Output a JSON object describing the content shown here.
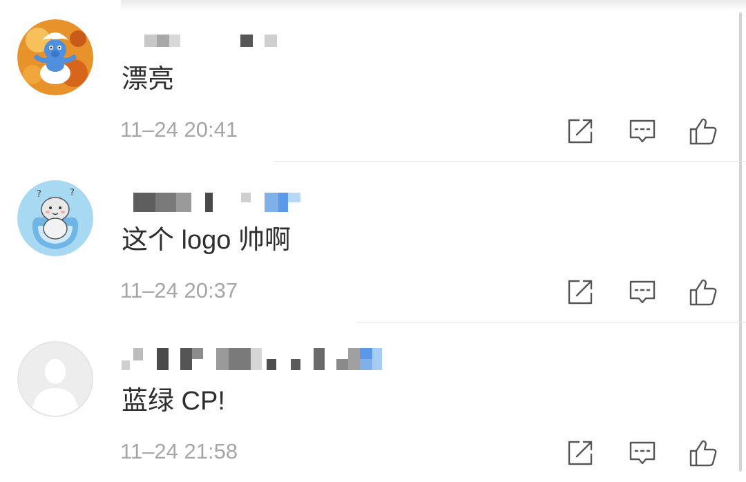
{
  "comments": [
    {
      "text": "漂亮",
      "timestamp": "11–24 20:41",
      "avatar_icon": "smurf-avatar-icon"
    },
    {
      "text": "这个 logo 帅啊",
      "timestamp": "11–24 20:37",
      "avatar_icon": "cartoon-avatar-icon"
    },
    {
      "text": "蓝绿 CP!",
      "timestamp": "11–24 21:58",
      "avatar_icon": "default-avatar-icon"
    }
  ],
  "actions": {
    "share_icon": "share-icon",
    "reply_icon": "reply-icon",
    "like_icon": "thumbs-up-icon"
  },
  "colors": {
    "text": "#2e2e2e",
    "meta": "#a6a6a6",
    "icon": "#555555",
    "divider": "#e6e6e6"
  }
}
